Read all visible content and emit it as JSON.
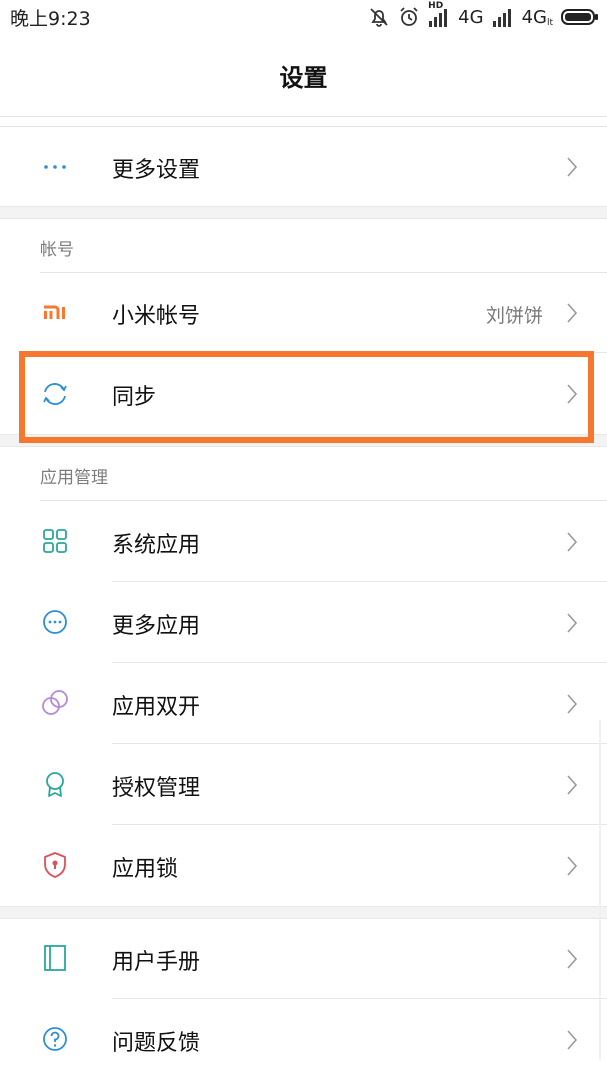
{
  "status_bar": {
    "time": "晚上9:23",
    "network_1": "4G",
    "network_2": "4G",
    "hd_label": "HD",
    "lte_label": "lt"
  },
  "header": {
    "title": "设置"
  },
  "rows": {
    "more_settings": {
      "label": "更多设置",
      "icon": "more-dots-icon"
    },
    "account_header": "帐号",
    "mi_account": {
      "label": "小米帐号",
      "value": "刘饼饼",
      "icon": "mi-logo-icon"
    },
    "sync": {
      "label": "同步",
      "icon": "sync-icon"
    },
    "app_mgmt_header": "应用管理",
    "system_apps": {
      "label": "系统应用",
      "icon": "grid-icon"
    },
    "more_apps": {
      "label": "更多应用",
      "icon": "more-circle-icon"
    },
    "dual_apps": {
      "label": "应用双开",
      "icon": "dual-circles-icon"
    },
    "permissions": {
      "label": "授权管理",
      "icon": "ribbon-icon"
    },
    "app_lock": {
      "label": "应用锁",
      "icon": "shield-lock-icon"
    },
    "user_guide": {
      "label": "用户手册",
      "icon": "book-icon"
    },
    "feedback": {
      "label": "问题反馈",
      "icon": "question-icon"
    }
  },
  "colors": {
    "accent_blue": "#2b8ed6",
    "mi_orange": "#f5782e",
    "teal": "#2aa79b",
    "purple": "#b68ad9",
    "red": "#e04e5c",
    "highlight": "#f5782e"
  }
}
